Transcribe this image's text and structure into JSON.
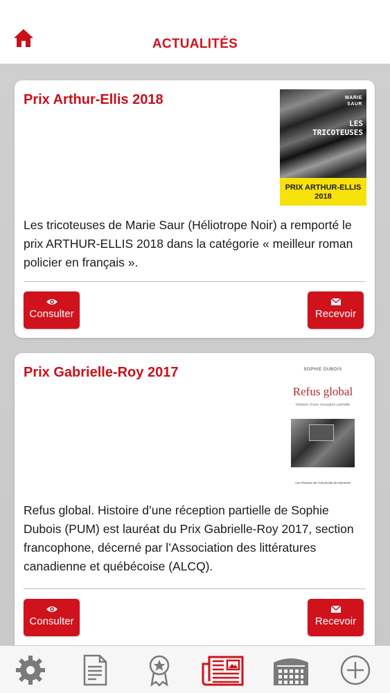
{
  "header": {
    "title": "ACTUALITÉS",
    "home_icon": "home-icon"
  },
  "colors": {
    "accent": "#d0121c",
    "background": "#cccccc",
    "status_battery": "#4cd964"
  },
  "articles": [
    {
      "title": "Prix Arthur-Ellis 2018",
      "body": "Les tricoteuses de Marie Saur (Héliotrope Noir) a remporté le prix ARTHUR-ELLIS 2018 dans la catégorie « meilleur roman policier en français ».",
      "cover": {
        "author_line1": "MARIE",
        "author_line2": "SAUR",
        "title_line1": "LES",
        "title_line2": "TRICOTEUSES",
        "band_line1": "PRIX ARTHUR-ELLIS",
        "band_line2": "2018"
      },
      "consult_label": "Consulter",
      "receive_label": "Recevoir"
    },
    {
      "title": "Prix Gabrielle-Roy 2017",
      "body": "Refus global. Histoire d’une réception partielle de Sophie Dubois (PUM) est lauréat du Prix Gabrielle-Roy 2017, section francophone, décerné par l’Association des littératures canadienne et québécoise (ALCQ).",
      "cover": {
        "author": "SOPHIE DUBOIS",
        "title": "Refus global",
        "subtitle": "Histoire d’une réception partielle",
        "publisher": "Les Presses de l’Université de Montréal"
      },
      "consult_label": "Consulter",
      "receive_label": "Recevoir"
    }
  ],
  "tabbar": {
    "items": [
      {
        "icon": "settings-gear-icon",
        "active": false
      },
      {
        "icon": "document-icon",
        "active": false
      },
      {
        "icon": "award-ribbon-icon",
        "active": false
      },
      {
        "icon": "newspaper-icon",
        "active": true
      },
      {
        "icon": "library-building-icon",
        "active": false
      },
      {
        "icon": "plus-circle-icon",
        "active": false
      }
    ]
  }
}
